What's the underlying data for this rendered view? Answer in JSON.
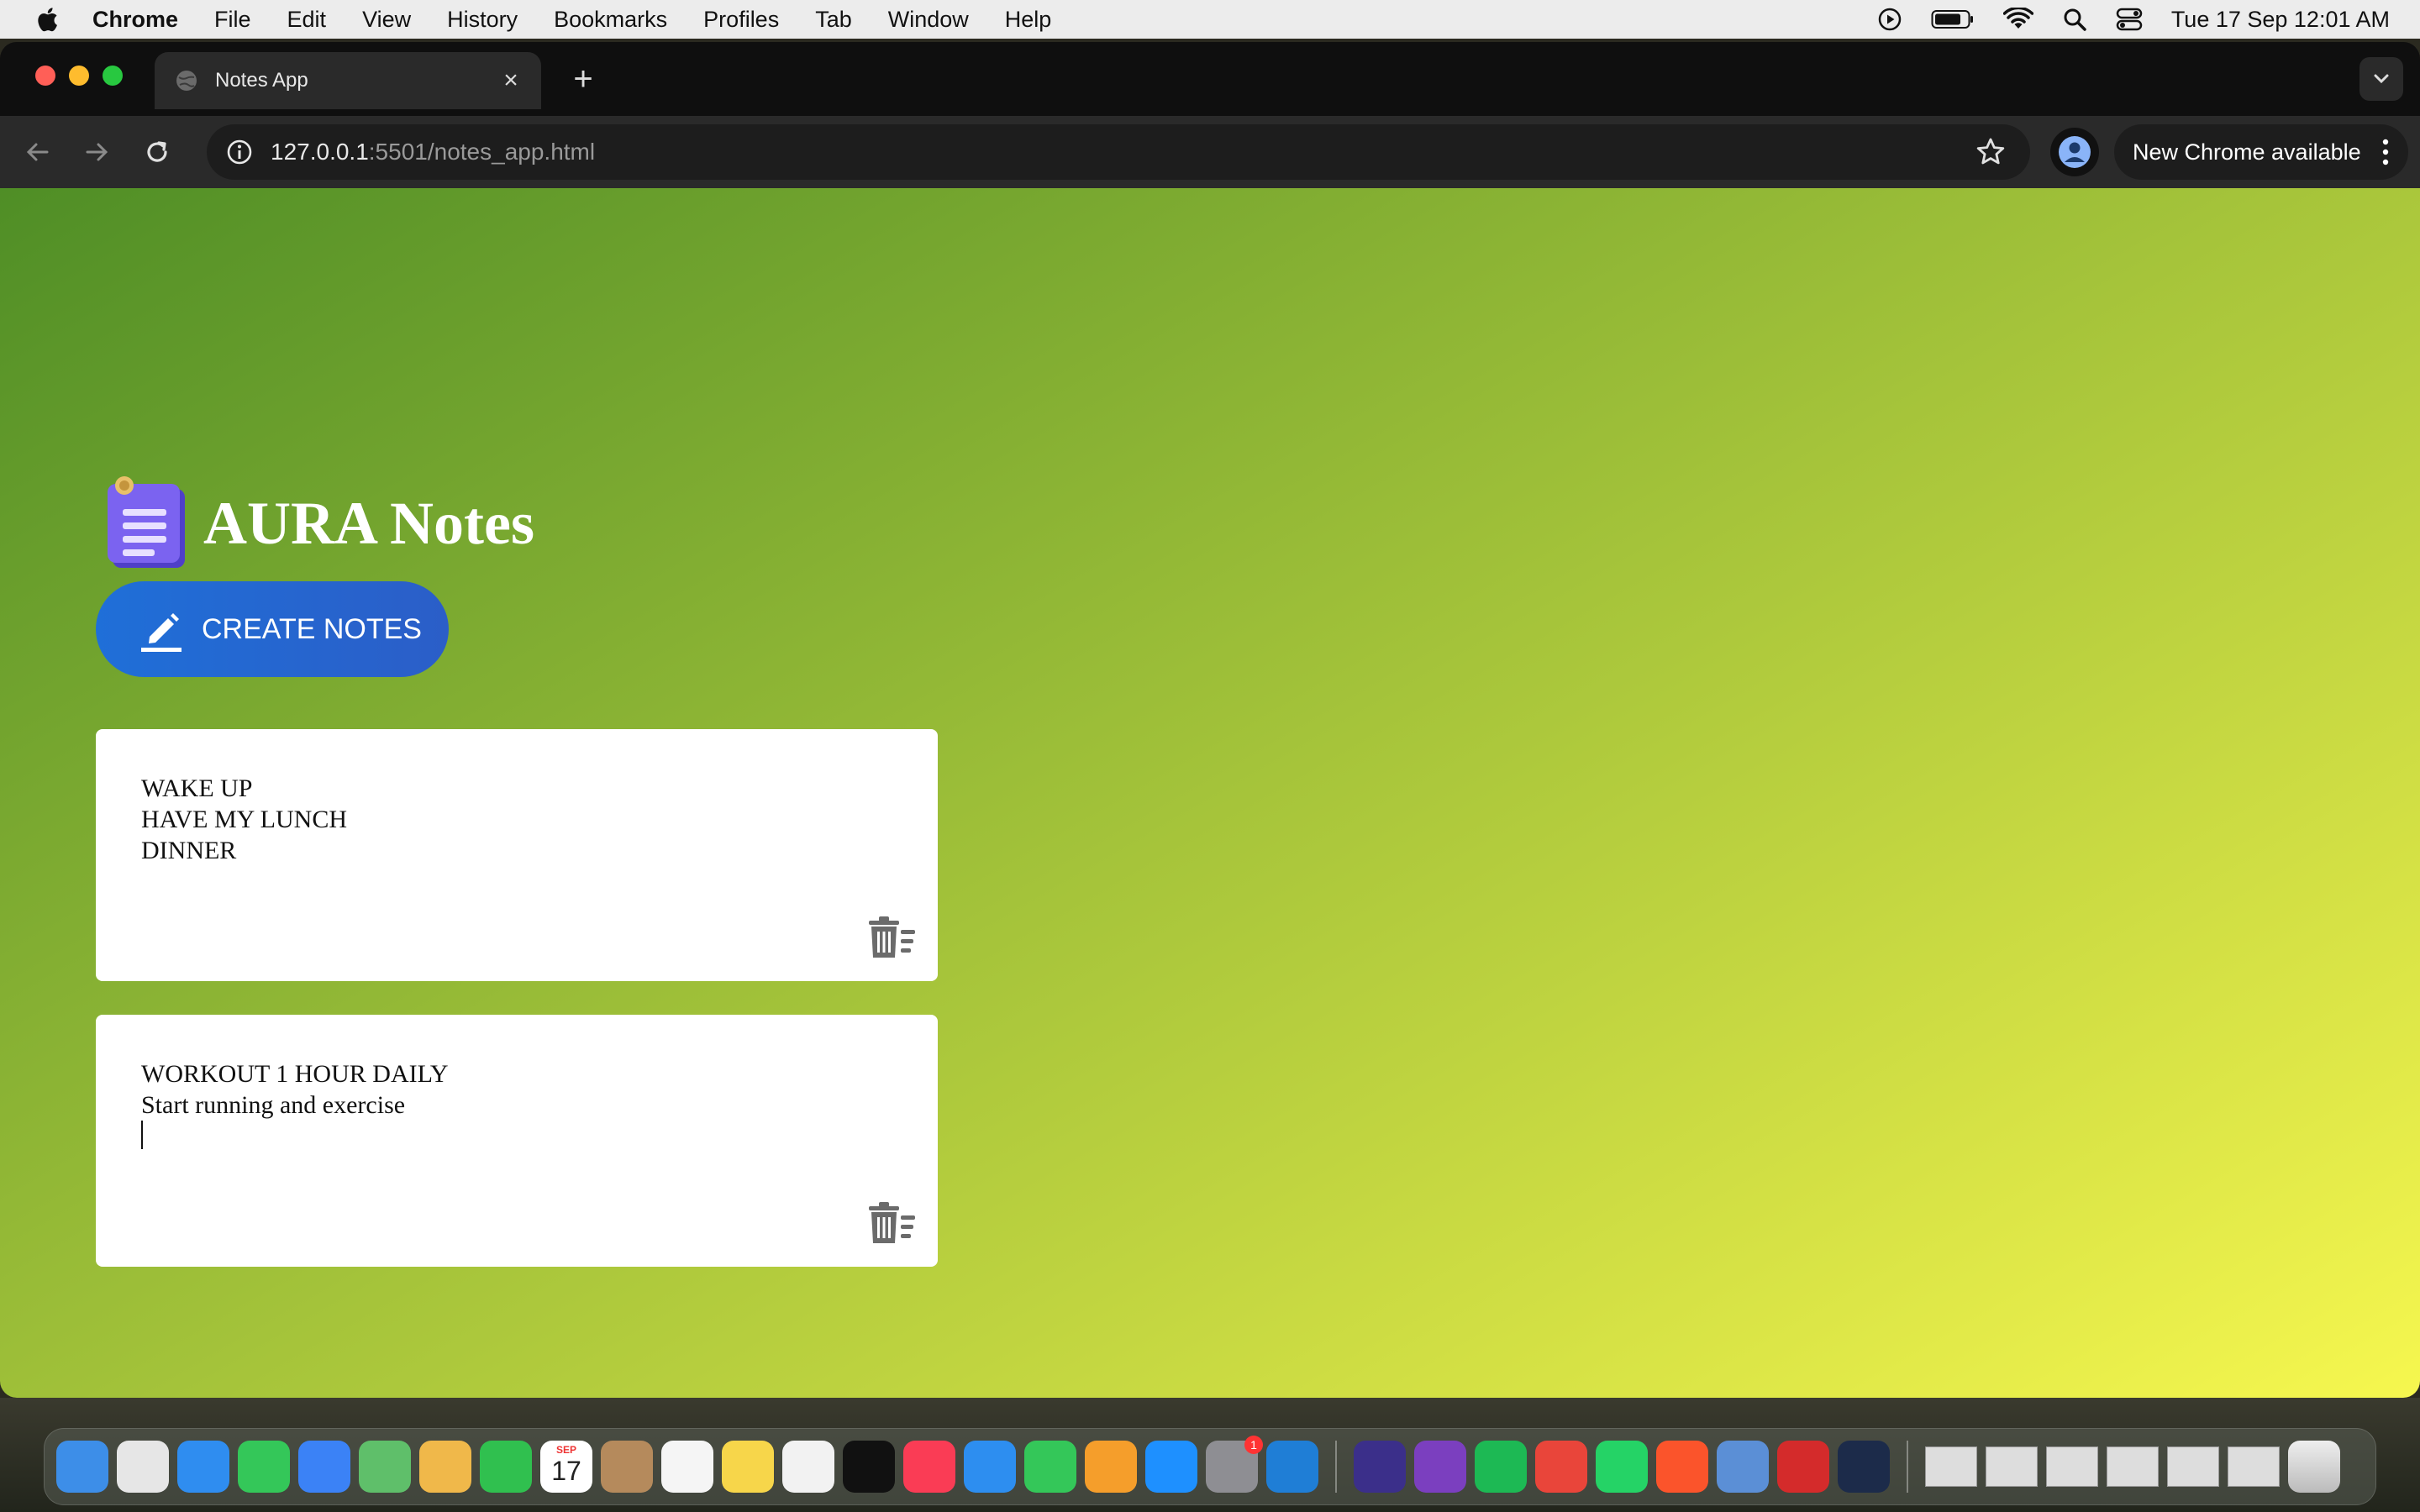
{
  "menubar": {
    "app_name": "Chrome",
    "items": [
      "File",
      "Edit",
      "View",
      "History",
      "Bookmarks",
      "Profiles",
      "Tab",
      "Window",
      "Help"
    ],
    "clock": "Tue 17 Sep  12:01 AM"
  },
  "browser": {
    "tab_title": "Notes App",
    "url_host": "127.0.0.1",
    "url_path": ":5501/notes_app.html",
    "update_label": "New Chrome available"
  },
  "app": {
    "title": "AURA Notes",
    "create_label": "CREATE NOTES",
    "notes": [
      {
        "text": "WAKE UP\nHAVE MY LUNCH\nDINNER"
      },
      {
        "text": "WORKOUT 1 HOUR DAILY\nStart running and exercise\n"
      }
    ]
  },
  "dock": {
    "apps": [
      {
        "icon": "finder-icon",
        "color": "#3d8ee8"
      },
      {
        "icon": "launchpad-icon",
        "color": "#e6e6e6"
      },
      {
        "icon": "safari-icon",
        "color": "#2f8df0"
      },
      {
        "icon": "messages-icon",
        "color": "#34c759"
      },
      {
        "icon": "mail-icon",
        "color": "#3b82f6"
      },
      {
        "icon": "maps-icon",
        "color": "#5fbf6a"
      },
      {
        "icon": "photos-icon",
        "color": "#f0b84a"
      },
      {
        "icon": "facetime-icon",
        "color": "#30c04f"
      },
      {
        "icon": "calendar-icon",
        "color": "#ffffff"
      },
      {
        "icon": "contacts-icon",
        "color": "#b58a5c"
      },
      {
        "icon": "reminders-icon",
        "color": "#f5f5f5"
      },
      {
        "icon": "notes-icon",
        "color": "#f7d64a"
      },
      {
        "icon": "freeform-icon",
        "color": "#f2f2f2"
      },
      {
        "icon": "tv-icon",
        "color": "#111111"
      },
      {
        "icon": "music-icon",
        "color": "#fa3c55"
      },
      {
        "icon": "keynote-icon",
        "color": "#2d8ef0"
      },
      {
        "icon": "numbers-icon",
        "color": "#34c759"
      },
      {
        "icon": "pages-icon",
        "color": "#f59e2b"
      },
      {
        "icon": "app-store-icon",
        "color": "#1e90ff"
      },
      {
        "icon": "system-settings-icon",
        "color": "#8e8e93"
      },
      {
        "icon": "vscode-icon",
        "color": "#1f7ed6"
      }
    ],
    "recent": [
      {
        "icon": "intellij-icon",
        "color": "#3b2f8a"
      },
      {
        "icon": "github-desktop-icon",
        "color": "#7b3fbf"
      },
      {
        "icon": "spotify-icon",
        "color": "#1db954"
      },
      {
        "icon": "chrome-icon",
        "color": "#e9453a"
      },
      {
        "icon": "whatsapp-icon",
        "color": "#25d366"
      },
      {
        "icon": "brave-icon",
        "color": "#fb542b"
      },
      {
        "icon": "preview-icon",
        "color": "#5b8fd6"
      },
      {
        "icon": "photo-booth-icon",
        "color": "#d42b2b"
      },
      {
        "icon": "quicktime-icon",
        "color": "#1c2b4a"
      }
    ],
    "calendar_month": "SEP",
    "calendar_day": "17",
    "settings_badge": "1"
  }
}
